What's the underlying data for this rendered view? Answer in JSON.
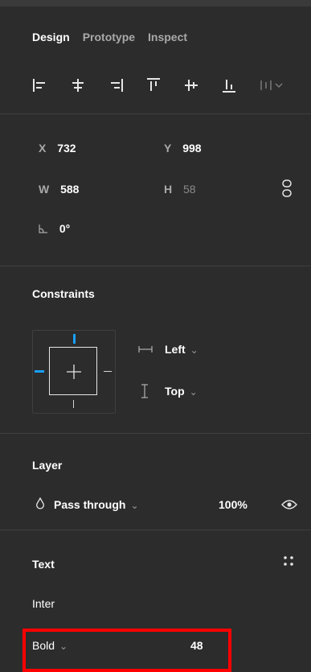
{
  "tabs": [
    {
      "label": "Design",
      "active": true
    },
    {
      "label": "Prototype",
      "active": false
    },
    {
      "label": "Inspect",
      "active": false
    }
  ],
  "align": {
    "icons": [
      "align-left-icon",
      "align-center-horizontal-icon",
      "align-right-icon",
      "align-top-icon",
      "align-center-vertical-icon",
      "align-bottom-icon",
      "distribute-icon"
    ]
  },
  "position": {
    "x": {
      "label": "X",
      "value": "732"
    },
    "y": {
      "label": "Y",
      "value": "998"
    },
    "w": {
      "label": "W",
      "value": "588"
    },
    "h": {
      "label": "H",
      "value": "58"
    },
    "rotation": {
      "value": "0°"
    }
  },
  "constraints": {
    "title": "Constraints",
    "horizontal": "Left",
    "vertical": "Top"
  },
  "layer": {
    "title": "Layer",
    "blend_mode": "Pass through",
    "opacity": "100%"
  },
  "text": {
    "title": "Text",
    "font_family": "Inter",
    "font_weight": "Bold",
    "font_size": "48"
  },
  "colors": {
    "panel_bg": "#2c2c2c",
    "highlight": "#ff0000",
    "constraint_accent": "#18a0fb"
  }
}
